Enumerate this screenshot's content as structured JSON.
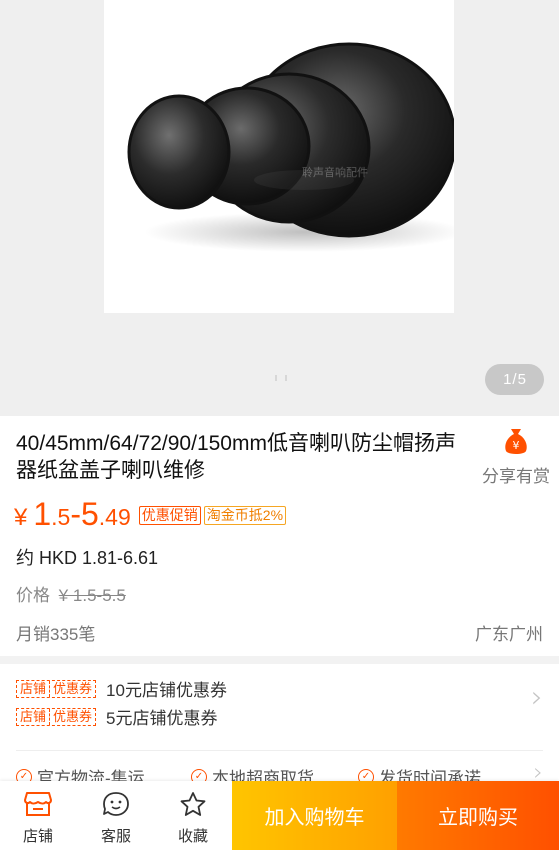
{
  "gallery": {
    "image_alt": "black speaker dust caps",
    "image_watermark": "聆声音响配件",
    "page_current": "1",
    "page_sep": "/",
    "page_total": "5"
  },
  "product": {
    "title": "40/45mm/64/72/90/150mm低音喇叭防尘帽扬声器纸盆盖子喇叭维修",
    "share_label": "分享有赏",
    "share_icon": "money-bag-icon",
    "currency": "¥",
    "price_int_low": "1",
    "price_dec_low": ".5",
    "price_sep": "-",
    "price_int_high": "5",
    "price_dec_high": ".49",
    "promo_tag": "优惠促销",
    "coin_tag": "淘金币抵2%",
    "hkd_price": "约 HKD 1.81-6.61",
    "orig_label": "价格",
    "orig_value": "¥ 1.5-5.5",
    "sales": "月销335笔",
    "location": "广东广州"
  },
  "coupons": [
    {
      "tag_a": "店铺",
      "tag_b": "优惠券",
      "text": "10元店铺优惠券"
    },
    {
      "tag_a": "店铺",
      "tag_b": "优惠券",
      "text": "5元店铺优惠券"
    }
  ],
  "services": [
    "官方物流-集运",
    "本地超商取货",
    "发货时间承诺"
  ],
  "bottom_bar": {
    "store_label": "店铺",
    "service_label": "客服",
    "favorite_label": "收藏",
    "add_cart_label": "加入购物车",
    "buy_now_label": "立即购买"
  },
  "colors": {
    "accent": "#ff5000",
    "cart_button": "#ffb000",
    "buy_button": "#ff6a00"
  }
}
